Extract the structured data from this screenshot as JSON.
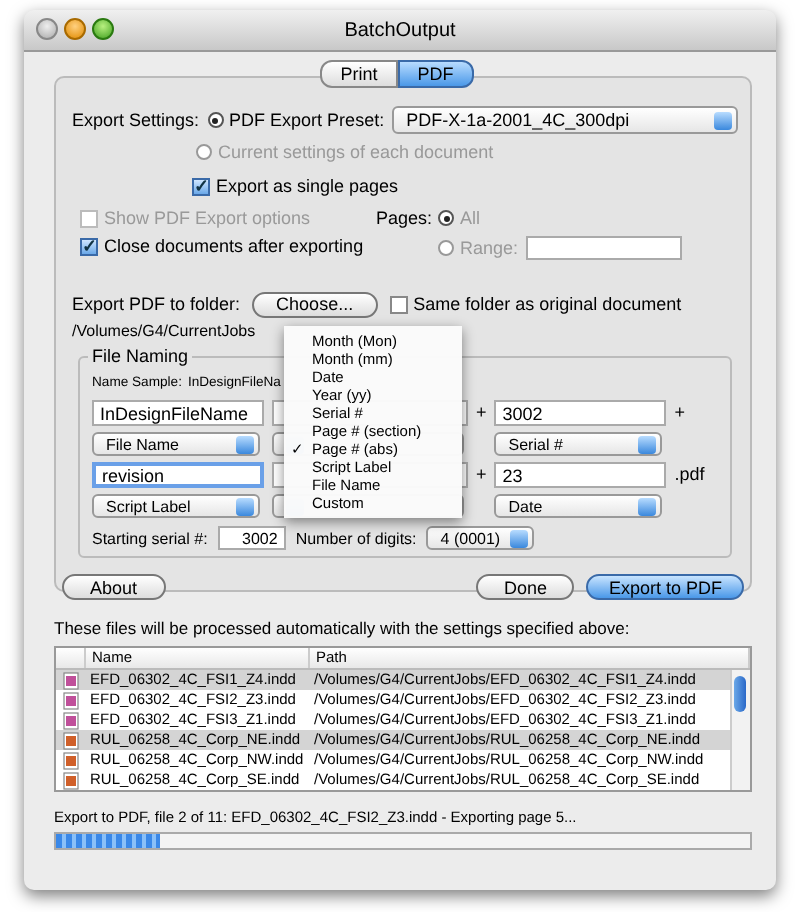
{
  "window": {
    "title": "BatchOutput"
  },
  "tabs": [
    {
      "label": "Print",
      "selected": false
    },
    {
      "label": "PDF",
      "selected": true
    }
  ],
  "export_settings": {
    "label": "Export Settings:",
    "options": [
      {
        "label": "PDF Export Preset:",
        "selected": true,
        "disabled": false
      },
      {
        "label": "Current settings of each document",
        "selected": false,
        "disabled": true
      }
    ],
    "preset": "PDF-X-1a-2001_4C_300dpi"
  },
  "single_pages": {
    "label": "Export as single pages",
    "checked": true,
    "disabled": false
  },
  "show_options": {
    "label": "Show PDF Export options",
    "checked": false,
    "disabled": true
  },
  "close_docs": {
    "label": "Close documents after exporting",
    "checked": true,
    "disabled": false
  },
  "pages": {
    "label": "Pages:",
    "options": [
      {
        "label": "All",
        "selected": true
      },
      {
        "label": "Range:",
        "selected": false
      }
    ]
  },
  "folder": {
    "label": "Export PDF to folder:",
    "button": "Choose...",
    "same_folder": {
      "label": "Same folder as original document",
      "checked": false
    },
    "path": "/Volumes/G4/CurrentJobs"
  },
  "file_naming": {
    "title": "File Naming",
    "sample_label": "Name Sample:",
    "sample": "InDesignFileNa",
    "rows": [
      {
        "first": {
          "value": "InDesignFileName",
          "popup": "File Name",
          "focused": false
        },
        "plus": "+",
        "last": {
          "value": "3002",
          "popup": "Serial #"
        },
        "end": "+"
      },
      {
        "first": {
          "value": "revision",
          "popup": "Script Label",
          "focused": true
        },
        "plus": "+",
        "last": {
          "value": "23",
          "popup": "Date"
        },
        "end": ".pdf"
      }
    ],
    "serial_label": "Starting serial #:",
    "serial": "3002",
    "digits_label": "Number of digits:",
    "digits": "4 (0001)"
  },
  "menu": {
    "items": [
      {
        "label": "Month (Mon)",
        "checked": false
      },
      {
        "label": "Month (mm)",
        "checked": false
      },
      {
        "label": "Date",
        "checked": false
      },
      {
        "label": "Year (yy)",
        "checked": false
      },
      {
        "label": "Serial #",
        "checked": false
      },
      {
        "label": "Page # (section)",
        "checked": false
      },
      {
        "label": "Page # (abs)",
        "checked": true
      },
      {
        "label": "Script Label",
        "checked": false
      },
      {
        "label": "File Name",
        "checked": false
      },
      {
        "label": "Custom",
        "checked": false
      }
    ],
    "check": "✓"
  },
  "buttons": [
    {
      "label": "About",
      "default": false
    },
    {
      "label": "Done",
      "default": false
    },
    {
      "label": "Export to PDF",
      "default": true
    }
  ],
  "files_intro": "These files will be processed automatically with the settings specified above:",
  "table": {
    "columns": [
      "Name",
      "Path"
    ],
    "rows": [
      {
        "name": "EFD_06302_4C_FSI1_Z4.indd",
        "path": "/Volumes/G4/CurrentJobs/EFD_06302_4C_FSI1_Z4.indd",
        "selected": true,
        "color": "#c0509a"
      },
      {
        "name": "EFD_06302_4C_FSI2_Z3.indd",
        "path": "/Volumes/G4/CurrentJobs/EFD_06302_4C_FSI2_Z3.indd",
        "selected": false,
        "color": "#c0509a"
      },
      {
        "name": "EFD_06302_4C_FSI3_Z1.indd",
        "path": "/Volumes/G4/CurrentJobs/EFD_06302_4C_FSI3_Z1.indd",
        "selected": false,
        "color": "#c0509a"
      },
      {
        "name": "RUL_06258_4C_Corp_NE.indd",
        "path": "/Volumes/G4/CurrentJobs/RUL_06258_4C_Corp_NE.indd",
        "selected": true,
        "color": "#d0602a"
      },
      {
        "name": "RUL_06258_4C_Corp_NW.indd",
        "path": "/Volumes/G4/CurrentJobs/RUL_06258_4C_Corp_NW.indd",
        "selected": false,
        "color": "#d0602a"
      },
      {
        "name": "RUL_06258_4C_Corp_SE.indd",
        "path": "/Volumes/G4/CurrentJobs/RUL_06258_4C_Corp_SE.indd",
        "selected": false,
        "color": "#d0602a"
      }
    ]
  },
  "status": "Export to PDF, file 2 of 11: EFD_06302_4C_FSI2_Z3.indd - Exporting page 5...",
  "progress": {
    "level": 0.15
  }
}
